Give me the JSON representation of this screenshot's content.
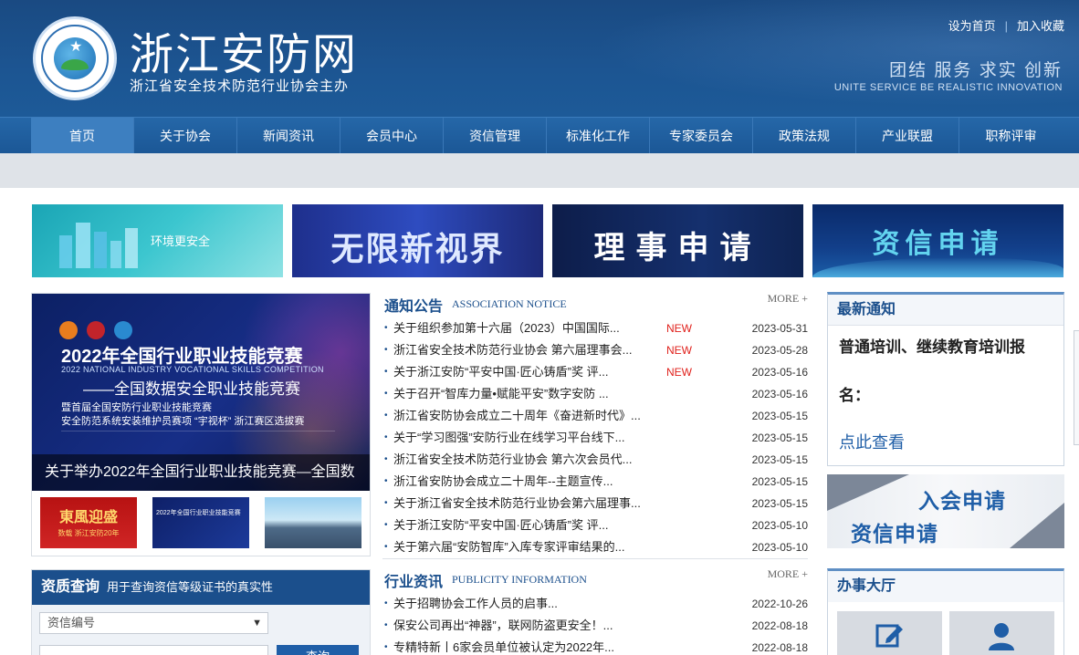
{
  "header": {
    "title": "浙江安防网",
    "subtitle": "浙江省安全技术防范行业协会主办",
    "top_links": [
      "设为首页",
      "加入收藏"
    ],
    "slogan": "团结 服务 求实 创新",
    "slogan_en": "UNITE SERVICE BE REALISTIC INNOVATION"
  },
  "nav": {
    "items": [
      "首页",
      "关于协会",
      "新闻资讯",
      "会员中心",
      "资信管理",
      "标准化工作",
      "专家委员会",
      "政策法规",
      "产业联盟",
      "职称评审"
    ],
    "active_index": 0
  },
  "banners": {
    "b1": "环境更安全",
    "b2": "无限新视界",
    "b3": "理事申请",
    "b4": "资信申请"
  },
  "feature": {
    "h1": "2022年全国行业职业技能竞赛",
    "h2": "2022 NATIONAL INDUSTRY VOCATIONAL SKILLS COMPETITION",
    "h3": "——全国数据安全职业技能竞赛",
    "h4": "暨首届全国安防行业职业技能竞赛",
    "h5": "安全防范系统安装维护员赛项 “宇视杯” 浙江赛区选拔赛",
    "caption": "关于举办2022年全国行业职业技能竞赛—全国数",
    "thumb1_title": "東風迎盛",
    "thumb1_sub": "数载 浙江安防20年",
    "thumb2_title": "2022年全国行业职业技能竞赛"
  },
  "query": {
    "title": "资质查询",
    "desc": "用于查询资信等级证书的真实性",
    "select_value": "资信编号",
    "button": "查询"
  },
  "notice": {
    "title_cn": "通知公告",
    "title_en": "ASSOCIATION NOTICE",
    "more": "MORE +",
    "items": [
      {
        "title": "关于组织参加第十六届（2023）中国国际...",
        "new": "NEW",
        "date": "2023-05-31"
      },
      {
        "title": "浙江省安全技术防范行业协会 第六届理事会...",
        "new": "NEW",
        "date": "2023-05-28"
      },
      {
        "title": "关于浙江安防“平安中国·匠心铸盾”奖 评...",
        "new": "NEW",
        "date": "2023-05-16"
      },
      {
        "title": "关于召开“智库力量•赋能平安”数字安防 ...",
        "new": "",
        "date": "2023-05-16"
      },
      {
        "title": "浙江省安防协会成立二十周年《奋进新时代》...",
        "new": "",
        "date": "2023-05-15"
      },
      {
        "title": "关于“学习图强”安防行业在线学习平台线下...",
        "new": "",
        "date": "2023-05-15"
      },
      {
        "title": "浙江省安全技术防范行业协会 第六次会员代...",
        "new": "",
        "date": "2023-05-15"
      },
      {
        "title": "浙江省安防协会成立二十周年--主题宣传...",
        "new": "",
        "date": "2023-05-15"
      },
      {
        "title": "关于浙江省安全技术防范行业协会第六届理事...",
        "new": "",
        "date": "2023-05-15"
      },
      {
        "title": "关于浙江安防“平安中国·匠心铸盾”奖 评...",
        "new": "",
        "date": "2023-05-10"
      },
      {
        "title": "关于第六届“安防智库”入库专家评审结果的...",
        "new": "",
        "date": "2023-05-10"
      }
    ]
  },
  "industry": {
    "title_cn": "行业资讯",
    "title_en": "PUBLICITY INFORMATION",
    "more": "MORE +",
    "items": [
      {
        "title": "关于招聘协会工作人员的启事...",
        "date": "2022-10-26"
      },
      {
        "title": "保安公司再出“神器”，联网防盗更安全！...",
        "date": "2022-08-18"
      },
      {
        "title": "专精特新丨6家会员单位被认定为2022年...",
        "date": "2022-08-18"
      }
    ]
  },
  "latest": {
    "title": "最新通知",
    "line1": "普通培训、继续教育培训报",
    "line2": "名：",
    "link": "点此查看"
  },
  "apply": {
    "line1": "入会申请",
    "line2": "资信申请"
  },
  "hall": {
    "title": "办事大厅",
    "icons": [
      "edit-icon",
      "user-icon"
    ]
  }
}
